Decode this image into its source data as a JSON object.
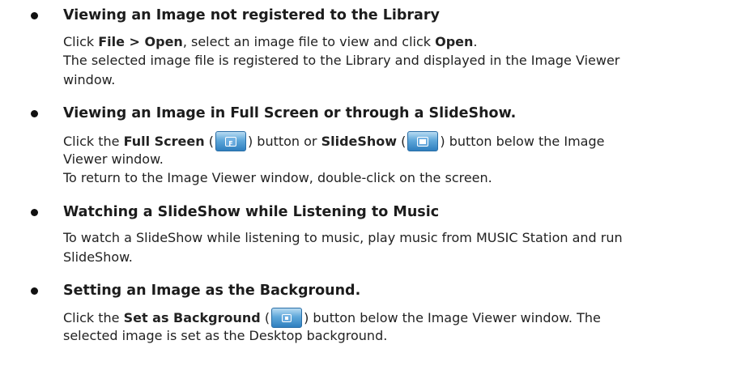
{
  "sections": [
    {
      "heading": "Viewing an Image not registered to the Library",
      "lines": [
        [
          "Click ",
          {
            "b": "File > Open"
          },
          ", select an image file to view and click ",
          {
            "b": "Open"
          },
          "."
        ],
        [
          "The selected image file is registered to the Library and displayed in the Image Viewer"
        ],
        [
          "window."
        ]
      ]
    },
    {
      "heading": "Viewing an Image in Full Screen or through a SlideShow.",
      "lines": [
        [
          "Click the ",
          {
            "b": "Full Screen"
          },
          " (",
          {
            "icon": "full-screen-button"
          },
          ") button or ",
          {
            "b": "SlideShow"
          },
          " (",
          {
            "icon": "slideshow-button"
          },
          ") button below the Image"
        ],
        [
          "Viewer window."
        ],
        [
          "To return to the Image Viewer window, double-click on the screen."
        ]
      ]
    },
    {
      "heading": "Watching a SlideShow while Listening to Music",
      "lines": [
        [
          "To watch a SlideShow while listening to music, play music from MUSIC Station and run"
        ],
        [
          "SlideShow."
        ]
      ]
    },
    {
      "heading": "Setting an Image as the Background.",
      "lines": [
        [
          "Click the ",
          {
            "b": "Set as Background"
          },
          " (",
          {
            "icon": "set-as-background-button"
          },
          ") button below the Image Viewer window. The"
        ],
        [
          "selected image is set as the Desktop background."
        ]
      ]
    }
  ],
  "icons": {
    "full-screen-button": {
      "glyph": "F",
      "accent": "#4a9ad6"
    },
    "slideshow-button": {
      "glyph": "",
      "accent": "#4a9ad6"
    },
    "set-as-background-button": {
      "glyph": "",
      "accent": "#4a9ad6"
    }
  }
}
